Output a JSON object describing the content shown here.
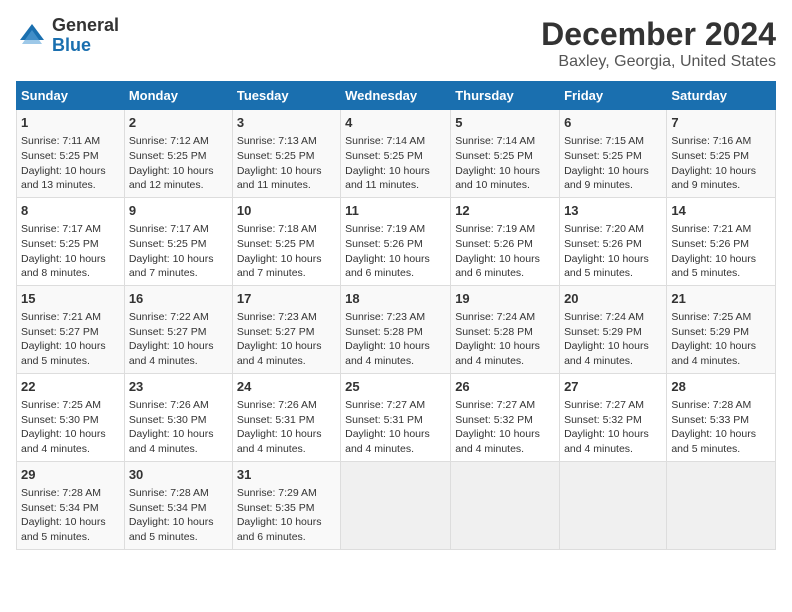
{
  "header": {
    "logo_general": "General",
    "logo_blue": "Blue",
    "title": "December 2024",
    "subtitle": "Baxley, Georgia, United States"
  },
  "calendar": {
    "days_of_week": [
      "Sunday",
      "Monday",
      "Tuesday",
      "Wednesday",
      "Thursday",
      "Friday",
      "Saturday"
    ],
    "weeks": [
      [
        {
          "day": "",
          "empty": true
        },
        {
          "day": "",
          "empty": true
        },
        {
          "day": "",
          "empty": true
        },
        {
          "day": "",
          "empty": true
        },
        {
          "day": "",
          "empty": true
        },
        {
          "day": "",
          "empty": true
        },
        {
          "day": "",
          "empty": true
        }
      ],
      [
        {
          "day": "1",
          "info": "Sunrise: 7:11 AM\nSunset: 5:25 PM\nDaylight: 10 hours\nand 13 minutes."
        },
        {
          "day": "2",
          "info": "Sunrise: 7:12 AM\nSunset: 5:25 PM\nDaylight: 10 hours\nand 12 minutes."
        },
        {
          "day": "3",
          "info": "Sunrise: 7:13 AM\nSunset: 5:25 PM\nDaylight: 10 hours\nand 11 minutes."
        },
        {
          "day": "4",
          "info": "Sunrise: 7:14 AM\nSunset: 5:25 PM\nDaylight: 10 hours\nand 11 minutes."
        },
        {
          "day": "5",
          "info": "Sunrise: 7:14 AM\nSunset: 5:25 PM\nDaylight: 10 hours\nand 10 minutes."
        },
        {
          "day": "6",
          "info": "Sunrise: 7:15 AM\nSunset: 5:25 PM\nDaylight: 10 hours\nand 9 minutes."
        },
        {
          "day": "7",
          "info": "Sunrise: 7:16 AM\nSunset: 5:25 PM\nDaylight: 10 hours\nand 9 minutes."
        }
      ],
      [
        {
          "day": "8",
          "info": "Sunrise: 7:17 AM\nSunset: 5:25 PM\nDaylight: 10 hours\nand 8 minutes."
        },
        {
          "day": "9",
          "info": "Sunrise: 7:17 AM\nSunset: 5:25 PM\nDaylight: 10 hours\nand 7 minutes."
        },
        {
          "day": "10",
          "info": "Sunrise: 7:18 AM\nSunset: 5:25 PM\nDaylight: 10 hours\nand 7 minutes."
        },
        {
          "day": "11",
          "info": "Sunrise: 7:19 AM\nSunset: 5:26 PM\nDaylight: 10 hours\nand 6 minutes."
        },
        {
          "day": "12",
          "info": "Sunrise: 7:19 AM\nSunset: 5:26 PM\nDaylight: 10 hours\nand 6 minutes."
        },
        {
          "day": "13",
          "info": "Sunrise: 7:20 AM\nSunset: 5:26 PM\nDaylight: 10 hours\nand 5 minutes."
        },
        {
          "day": "14",
          "info": "Sunrise: 7:21 AM\nSunset: 5:26 PM\nDaylight: 10 hours\nand 5 minutes."
        }
      ],
      [
        {
          "day": "15",
          "info": "Sunrise: 7:21 AM\nSunset: 5:27 PM\nDaylight: 10 hours\nand 5 minutes."
        },
        {
          "day": "16",
          "info": "Sunrise: 7:22 AM\nSunset: 5:27 PM\nDaylight: 10 hours\nand 4 minutes."
        },
        {
          "day": "17",
          "info": "Sunrise: 7:23 AM\nSunset: 5:27 PM\nDaylight: 10 hours\nand 4 minutes."
        },
        {
          "day": "18",
          "info": "Sunrise: 7:23 AM\nSunset: 5:28 PM\nDaylight: 10 hours\nand 4 minutes."
        },
        {
          "day": "19",
          "info": "Sunrise: 7:24 AM\nSunset: 5:28 PM\nDaylight: 10 hours\nand 4 minutes."
        },
        {
          "day": "20",
          "info": "Sunrise: 7:24 AM\nSunset: 5:29 PM\nDaylight: 10 hours\nand 4 minutes."
        },
        {
          "day": "21",
          "info": "Sunrise: 7:25 AM\nSunset: 5:29 PM\nDaylight: 10 hours\nand 4 minutes."
        }
      ],
      [
        {
          "day": "22",
          "info": "Sunrise: 7:25 AM\nSunset: 5:30 PM\nDaylight: 10 hours\nand 4 minutes."
        },
        {
          "day": "23",
          "info": "Sunrise: 7:26 AM\nSunset: 5:30 PM\nDaylight: 10 hours\nand 4 minutes."
        },
        {
          "day": "24",
          "info": "Sunrise: 7:26 AM\nSunset: 5:31 PM\nDaylight: 10 hours\nand 4 minutes."
        },
        {
          "day": "25",
          "info": "Sunrise: 7:27 AM\nSunset: 5:31 PM\nDaylight: 10 hours\nand 4 minutes."
        },
        {
          "day": "26",
          "info": "Sunrise: 7:27 AM\nSunset: 5:32 PM\nDaylight: 10 hours\nand 4 minutes."
        },
        {
          "day": "27",
          "info": "Sunrise: 7:27 AM\nSunset: 5:32 PM\nDaylight: 10 hours\nand 4 minutes."
        },
        {
          "day": "28",
          "info": "Sunrise: 7:28 AM\nSunset: 5:33 PM\nDaylight: 10 hours\nand 5 minutes."
        }
      ],
      [
        {
          "day": "29",
          "info": "Sunrise: 7:28 AM\nSunset: 5:34 PM\nDaylight: 10 hours\nand 5 minutes."
        },
        {
          "day": "30",
          "info": "Sunrise: 7:28 AM\nSunset: 5:34 PM\nDaylight: 10 hours\nand 5 minutes."
        },
        {
          "day": "31",
          "info": "Sunrise: 7:29 AM\nSunset: 5:35 PM\nDaylight: 10 hours\nand 6 minutes."
        },
        {
          "day": "",
          "empty": true
        },
        {
          "day": "",
          "empty": true
        },
        {
          "day": "",
          "empty": true
        },
        {
          "day": "",
          "empty": true
        }
      ]
    ]
  }
}
